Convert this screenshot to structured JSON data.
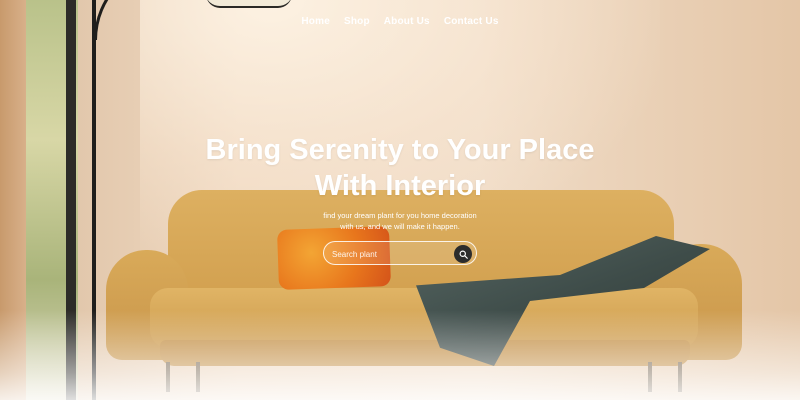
{
  "nav": {
    "items": [
      {
        "label": "Home"
      },
      {
        "label": "Shop"
      },
      {
        "label": "About Us"
      },
      {
        "label": "Contact Us"
      }
    ]
  },
  "hero": {
    "title_line1": "Bring Serenity to Your Place",
    "title_line2": "With Interior",
    "subtitle_line1": "find your dream plant for you home decoration",
    "subtitle_line2": "with us, and we will make it happen."
  },
  "search": {
    "placeholder": "Search plant",
    "icon": "search-icon"
  },
  "colors": {
    "text": "#ffffff",
    "search_button": "#2c2c2c",
    "sofa": "#d4a253"
  }
}
